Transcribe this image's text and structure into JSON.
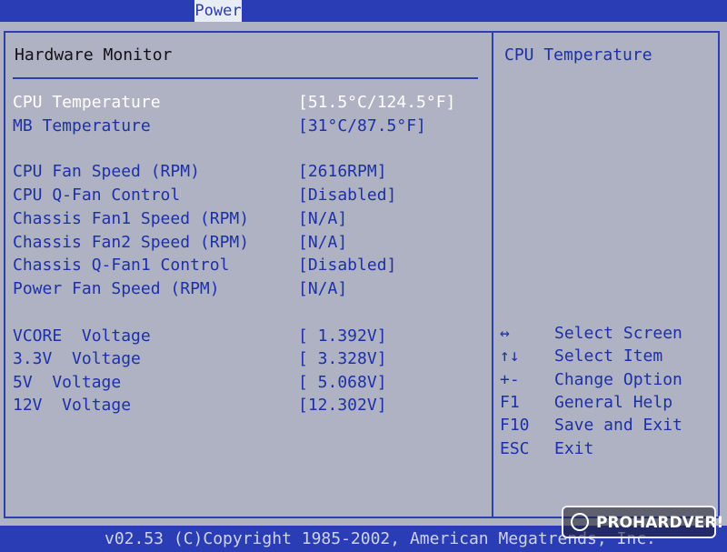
{
  "menu": {
    "active_tab": "Power"
  },
  "section": {
    "title": "Hardware Monitor"
  },
  "items": [
    {
      "label": "CPU Temperature",
      "value": "[51.5°C/124.5°F]",
      "selected": true
    },
    {
      "label": "MB Temperature",
      "value": "[31°C/87.5°F]"
    },
    {
      "label": "CPU Fan Speed (RPM)",
      "value": "[2616RPM]"
    },
    {
      "label": "CPU Q-Fan Control",
      "value": "[Disabled]"
    },
    {
      "label": "Chassis Fan1 Speed (RPM)",
      "value": "[N/A]"
    },
    {
      "label": "Chassis Fan2 Speed (RPM)",
      "value": "[N/A]"
    },
    {
      "label": "Chassis Q-Fan1 Control",
      "value": "[Disabled]"
    },
    {
      "label": "Power Fan Speed (RPM)",
      "value": "[N/A]"
    },
    {
      "label": "VCORE  Voltage",
      "value": "[ 1.392V]"
    },
    {
      "label": "3.3V  Voltage",
      "value": "[ 3.328V]"
    },
    {
      "label": "5V  Voltage",
      "value": "[ 5.068V]"
    },
    {
      "label": "12V  Voltage",
      "value": "[12.302V]"
    }
  ],
  "help": {
    "title": "CPU Temperature",
    "keys": [
      {
        "key": "↔",
        "desc": "Select Screen"
      },
      {
        "key": "↑↓",
        "desc": "Select Item"
      },
      {
        "key": "+-",
        "desc": "Change Option"
      },
      {
        "key": "F1",
        "desc": "General Help"
      },
      {
        "key": "F10",
        "desc": "Save and Exit"
      },
      {
        "key": "ESC",
        "desc": "Exit"
      }
    ]
  },
  "footer": {
    "text": "v02.53 (C)Copyright 1985-2002, American Megatrends, Inc."
  },
  "watermark": {
    "text": "PROHARDVER!"
  },
  "colors": {
    "background": "#aeb2c2",
    "accent_blue": "#1e30a8",
    "selected_text": "#ffffff",
    "bar": "#2a3db4"
  }
}
